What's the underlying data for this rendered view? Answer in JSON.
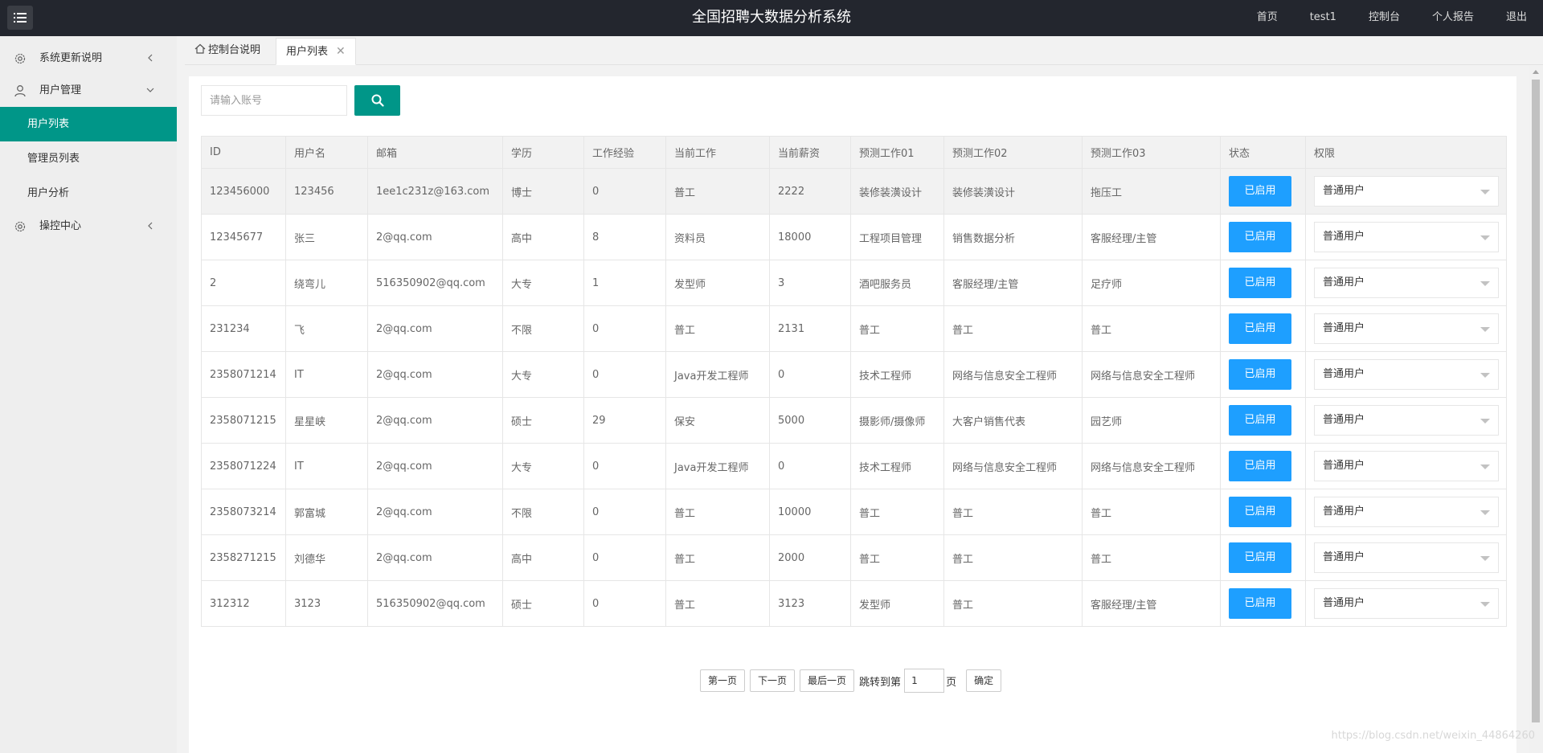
{
  "header": {
    "title": "全国招聘大数据分析系统",
    "nav": [
      "首页",
      "test1",
      "控制台",
      "个人报告",
      "退出"
    ]
  },
  "sidebar": {
    "groups": [
      {
        "label": "系统更新说明",
        "icon": "gear-icon",
        "expanded": false
      },
      {
        "label": "用户管理",
        "icon": "user-icon",
        "expanded": true,
        "children": [
          "用户列表",
          "管理员列表",
          "用户分析"
        ],
        "active_child": "用户列表"
      },
      {
        "label": "操控中心",
        "icon": "gear-icon",
        "expanded": false
      }
    ]
  },
  "tabs": [
    {
      "label": "控制台说明",
      "icon": "home-icon",
      "active": false
    },
    {
      "label": "用户列表",
      "active": true,
      "closable": true
    }
  ],
  "search": {
    "placeholder": "请输入账号",
    "button_icon": "search-icon"
  },
  "table": {
    "columns": [
      "ID",
      "用户名",
      "邮箱",
      "学历",
      "工作经验",
      "当前工作",
      "当前薪资",
      "预测工作01",
      "预测工作02",
      "预测工作03",
      "状态",
      "权限"
    ],
    "rows": [
      [
        "123456000",
        "123456",
        "1ee1c231z@163.com",
        "博士",
        "0",
        "普工",
        "2222",
        "装修装潢设计",
        "装修装潢设计",
        "拖压工",
        "已启用",
        "普通用户"
      ],
      [
        "12345677",
        "张三",
        "2@qq.com",
        "高中",
        "8",
        "资料员",
        "18000",
        "工程项目管理",
        "销售数据分析",
        "客服经理/主管",
        "已启用",
        "普通用户"
      ],
      [
        "2",
        "绕弯儿",
        "516350902@qq.com",
        "大专",
        "1",
        "发型师",
        "3",
        "酒吧服务员",
        "客服经理/主管",
        "足疗师",
        "已启用",
        "普通用户"
      ],
      [
        "231234",
        "飞",
        "2@qq.com",
        "不限",
        "0",
        "普工",
        "2131",
        "普工",
        "普工",
        "普工",
        "已启用",
        "普通用户"
      ],
      [
        "2358071214",
        "IT",
        "2@qq.com",
        "大专",
        "0",
        "Java开发工程师",
        "0",
        "技术工程师",
        "网络与信息安全工程师",
        "网络与信息安全工程师",
        "已启用",
        "普通用户"
      ],
      [
        "2358071215",
        "星星峡",
        "2@qq.com",
        "硕士",
        "29",
        "保安",
        "5000",
        "摄影师/摄像师",
        "大客户销售代表",
        "园艺师",
        "已启用",
        "普通用户"
      ],
      [
        "2358071224",
        "IT",
        "2@qq.com",
        "大专",
        "0",
        "Java开发工程师",
        "0",
        "技术工程师",
        "网络与信息安全工程师",
        "网络与信息安全工程师",
        "已启用",
        "普通用户"
      ],
      [
        "2358073214",
        "郭富城",
        "2@qq.com",
        "不限",
        "0",
        "普工",
        "10000",
        "普工",
        "普工",
        "普工",
        "已启用",
        "普通用户"
      ],
      [
        "2358271215",
        "刘德华",
        "2@qq.com",
        "高中",
        "0",
        "普工",
        "2000",
        "普工",
        "普工",
        "普工",
        "已启用",
        "普通用户"
      ],
      [
        "312312",
        "3123",
        "516350902@qq.com",
        "硕士",
        "0",
        "普工",
        "3123",
        "发型师",
        "普工",
        "客服经理/主管",
        "已启用",
        "普通用户"
      ]
    ]
  },
  "pagination": {
    "first": "第一页",
    "next": "下一页",
    "last": "最后一页",
    "jump_label": "跳转到第",
    "page_value": "1",
    "page_suffix": "页",
    "confirm": "确定"
  },
  "watermark": "https://blog.csdn.net/weixin_44864260",
  "colors": {
    "accent": "#009688",
    "status": "#1e9fff",
    "header": "#23262e"
  }
}
